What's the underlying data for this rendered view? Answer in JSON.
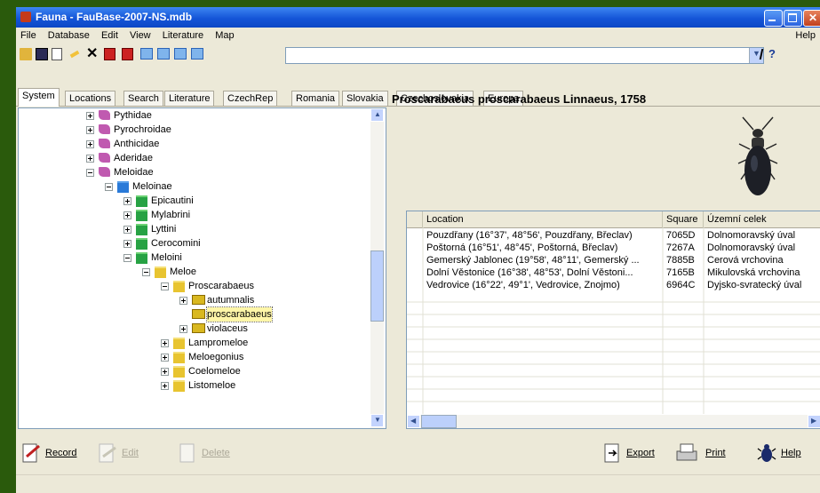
{
  "window": {
    "title": "Fauna - FauBase-2007-NS.mdb"
  },
  "menu": {
    "items": [
      "File",
      "Database",
      "Edit",
      "View",
      "Literature",
      "Map"
    ],
    "help": "Help"
  },
  "toolbar": {
    "buttons": [
      "open-icon",
      "save-icon",
      "new-icon",
      "edit-icon",
      "delete-icon",
      "filter-icon",
      "filter2-icon",
      "view1-icon",
      "view2-icon",
      "view3-icon",
      "view4-icon"
    ],
    "combo_value": ""
  },
  "tabs": [
    "System",
    "Locations",
    "Search",
    "Literature",
    "CzechRep",
    "Romania",
    "Slovakia",
    "Czechoslovakia",
    "Europa"
  ],
  "active_tab": "System",
  "tree": [
    {
      "label": "Pythidae",
      "level": 0,
      "icon": "book",
      "expander": "plus"
    },
    {
      "label": "Pyrochroidae",
      "level": 0,
      "icon": "book",
      "expander": "plus"
    },
    {
      "label": "Anthicidae",
      "level": 0,
      "icon": "book",
      "expander": "plus"
    },
    {
      "label": "Aderidae",
      "level": 0,
      "icon": "book",
      "expander": "plus"
    },
    {
      "label": "Meloidae",
      "level": 0,
      "icon": "book",
      "expander": "minus"
    },
    {
      "label": "Meloinae",
      "level": 1,
      "icon": "fblue",
      "expander": "minus"
    },
    {
      "label": "Epicautini",
      "level": 2,
      "icon": "fgreen",
      "expander": "plus"
    },
    {
      "label": "Mylabrini",
      "level": 2,
      "icon": "fgreen",
      "expander": "plus"
    },
    {
      "label": "Lyttini",
      "level": 2,
      "icon": "fgreen",
      "expander": "plus"
    },
    {
      "label": "Cerocomini",
      "level": 2,
      "icon": "fgreen",
      "expander": "plus"
    },
    {
      "label": "Meloini",
      "level": 2,
      "icon": "fgreen",
      "expander": "minus"
    },
    {
      "label": "Meloe",
      "level": 3,
      "icon": "fyel",
      "expander": "minus"
    },
    {
      "label": "Proscarabaeus",
      "level": 4,
      "icon": "fyel",
      "expander": "minus"
    },
    {
      "label": "autumnalis",
      "level": 5,
      "icon": "fyel2",
      "expander": "plus"
    },
    {
      "label": "proscarabaeus",
      "level": 5,
      "icon": "fyel2",
      "expander": "none",
      "selected": true
    },
    {
      "label": "violaceus",
      "level": 5,
      "icon": "fyel2",
      "expander": "plus"
    },
    {
      "label": "Lampromeloe",
      "level": 4,
      "icon": "fyel",
      "expander": "plus"
    },
    {
      "label": "Meloegonius",
      "level": 4,
      "icon": "fyel",
      "expander": "plus"
    },
    {
      "label": "Coelomeloe",
      "level": 4,
      "icon": "fyel",
      "expander": "plus"
    },
    {
      "label": "Listomeloe",
      "level": 4,
      "icon": "fyel",
      "expander": "plus"
    }
  ],
  "species_title": "Proscarabaeus proscarabaeus Linnaeus, 1758",
  "grid": {
    "headers": [
      "Location",
      "Square",
      "Územní celek"
    ],
    "rows": [
      [
        "Pouzdřany (16°37', 48°56', Pouzdřany, Břeclav)",
        "7065D",
        "Dolnomoravský úval"
      ],
      [
        "Poštorná (16°51', 48°45', Poštorná, Břeclav)",
        "7267A",
        "Dolnomoravský úval"
      ],
      [
        "Gemerský Jablonec (19°58', 48°11', Gemerský ...",
        "7885B",
        "Cerová vrchovina"
      ],
      [
        "Dolní Věstonice (16°38', 48°53', Dolní Věstoni...",
        "7165B",
        "Mikulovská vrchovina"
      ],
      [
        "Vedrovice (16°22', 49°1', Vedrovice, Znojmo)",
        "6964C",
        "Dyjsko-svratecký úval"
      ]
    ]
  },
  "bottom_buttons": [
    {
      "label": "Record",
      "icon": "record-icon",
      "enabled": true
    },
    {
      "label": "Edit",
      "icon": "edit-record-icon",
      "enabled": false
    },
    {
      "label": "Delete",
      "icon": "delete-record-icon",
      "enabled": false
    },
    {
      "label": "Export",
      "icon": "export-icon",
      "enabled": true
    },
    {
      "label": "Print",
      "icon": "print-icon",
      "enabled": true
    },
    {
      "label": "Help",
      "icon": "help-beetle-icon",
      "enabled": true
    }
  ],
  "colors": {
    "titlebar": "#1555d8",
    "background": "#2a5a0c",
    "selection": "#fff6a8"
  }
}
